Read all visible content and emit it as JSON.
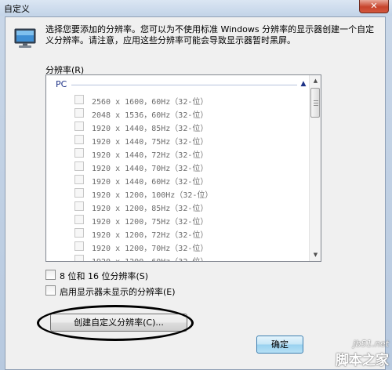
{
  "window": {
    "title": "自定义",
    "close_glyph": "✕"
  },
  "description": "选择您要添加的分辨率。您可以为不使用标准 Windows 分辨率的显示器创建一个自定义分辨率。请注意，应用这些分辨率可能会导致显示器暂时黑屏。",
  "resolution_label": "分辨率(R)",
  "group": {
    "name": "PC",
    "collapse_glyph": "▲"
  },
  "resolutions": [
    {
      "label": "2560 x 1600，60Hz（32-位）",
      "checked": false
    },
    {
      "label": "2048 x 1536，60Hz（32-位）",
      "checked": false
    },
    {
      "label": "1920 x 1440，85Hz（32-位）",
      "checked": false
    },
    {
      "label": "1920 x 1440，75Hz（32-位）",
      "checked": false
    },
    {
      "label": "1920 x 1440，72Hz（32-位）",
      "checked": false
    },
    {
      "label": "1920 x 1440，70Hz（32-位）",
      "checked": false
    },
    {
      "label": "1920 x 1440，60Hz（32-位）",
      "checked": false
    },
    {
      "label": "1920 x 1200，100Hz（32-位）",
      "checked": false
    },
    {
      "label": "1920 x 1200，85Hz（32-位）",
      "checked": false
    },
    {
      "label": "1920 x 1200，75Hz（32-位）",
      "checked": false
    },
    {
      "label": "1920 x 1200，72Hz（32-位）",
      "checked": false
    },
    {
      "label": "1920 x 1200，70Hz（32-位）",
      "checked": false
    },
    {
      "label": "1920 x 1200，60Hz（32-位）",
      "checked": false
    }
  ],
  "scrollbar": {
    "up_glyph": "▲",
    "down_glyph": "▼"
  },
  "options": {
    "bit8_16_label": "8 位和 16 位分辨率(S)",
    "bit8_16_checked": false,
    "hidden_modes_label": "启用显示器未显示的分辨率(E)",
    "hidden_modes_checked": false
  },
  "buttons": {
    "create_custom_label": "创建自定义分辨率(C)...",
    "ok_label": "确定"
  },
  "watermark": {
    "url": "jb51.net",
    "name": "脚本之家"
  }
}
